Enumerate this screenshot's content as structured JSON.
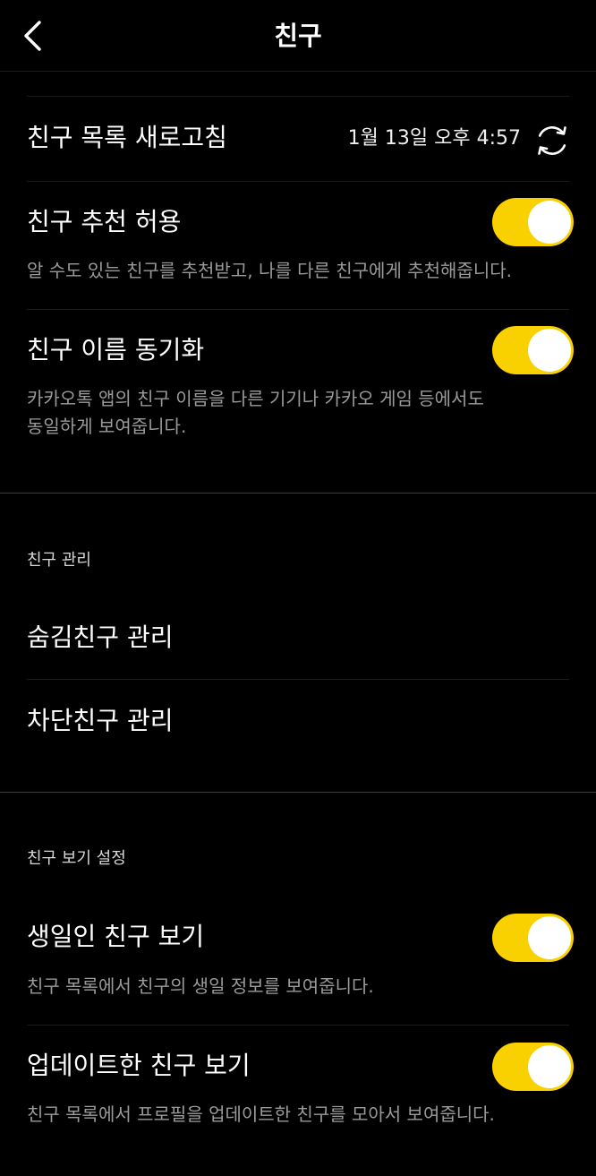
{
  "header": {
    "title": "친구"
  },
  "settings": {
    "refresh": {
      "label": "친구 목록 새로고침",
      "time": "1월 13일 오후 4:57"
    },
    "recommend": {
      "label": "친구 추천 허용",
      "description": "알 수도 있는 친구를 추천받고, 나를 다른 친구에게 추천해줍니다.",
      "enabled": true
    },
    "name_sync": {
      "label": "친구 이름 동기화",
      "description_line1": "카카오톡 앱의 친구 이름을 다른 기기나 카카오 게임 등에서도",
      "description_line2": "동일하게 보여줍니다.",
      "enabled": true
    }
  },
  "manage": {
    "section_label": "친구 관리",
    "hidden": "숨김친구 관리",
    "blocked": "차단친구 관리"
  },
  "view": {
    "section_label": "친구 보기 설정",
    "birthday": {
      "label": "생일인 친구 보기",
      "description": "친구 목록에서 친구의 생일 정보를 보여줍니다.",
      "enabled": true
    },
    "updated": {
      "label": "업데이트한 친구 보기",
      "description": "친구 목록에서 프로필을 업데이트한 친구를 모아서 보여줍니다.",
      "enabled": true
    }
  },
  "colors": {
    "toggle_on": "#f9d000",
    "background": "#000000",
    "description_text": "#9a9a9a"
  },
  "icons": {
    "back": "chevron-left-icon",
    "refresh": "refresh-icon"
  }
}
